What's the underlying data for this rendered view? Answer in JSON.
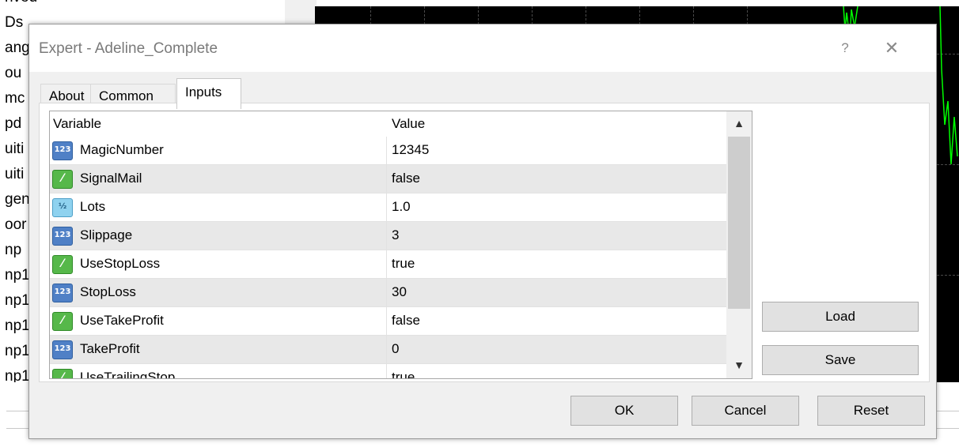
{
  "background": {
    "nav_fragments": [
      "rived",
      "Ds",
      "ang",
      "ou",
      "mc",
      "pd",
      "uiti",
      "uiti",
      "gen",
      "oor",
      "np",
      "np1",
      "np1",
      "np1",
      "np1",
      "np1"
    ]
  },
  "dialog": {
    "title": "Expert - Adeline_Complete",
    "help_label": "?",
    "close_label": "✕",
    "tabs": [
      {
        "label": "About",
        "active": false
      },
      {
        "label": "Common",
        "active": false
      },
      {
        "label": "Inputs",
        "active": true
      }
    ],
    "grid": {
      "columns": [
        "Variable",
        "Value"
      ],
      "rows": [
        {
          "icon": "int-icon",
          "type": "int",
          "variable": "MagicNumber",
          "value": "12345"
        },
        {
          "icon": "bool-icon",
          "type": "bool",
          "variable": "SignalMail",
          "value": "false"
        },
        {
          "icon": "double-icon",
          "type": "double",
          "variable": "Lots",
          "value": "1.0"
        },
        {
          "icon": "int-icon",
          "type": "int",
          "variable": "Slippage",
          "value": "3"
        },
        {
          "icon": "bool-icon",
          "type": "bool",
          "variable": "UseStopLoss",
          "value": "true"
        },
        {
          "icon": "int-icon",
          "type": "int",
          "variable": "StopLoss",
          "value": "30"
        },
        {
          "icon": "bool-icon",
          "type": "bool",
          "variable": "UseTakeProfit",
          "value": "false"
        },
        {
          "icon": "int-icon",
          "type": "int",
          "variable": "TakeProfit",
          "value": "0"
        },
        {
          "icon": "bool-icon",
          "type": "bool",
          "variable": "UseTrailingStop",
          "value": "true"
        }
      ],
      "scroll_up": "▲",
      "scroll_down": "▼"
    },
    "side_buttons": {
      "load": "Load",
      "save": "Save"
    },
    "footer_buttons": {
      "ok": "OK",
      "cancel": "Cancel",
      "reset": "Reset"
    }
  }
}
